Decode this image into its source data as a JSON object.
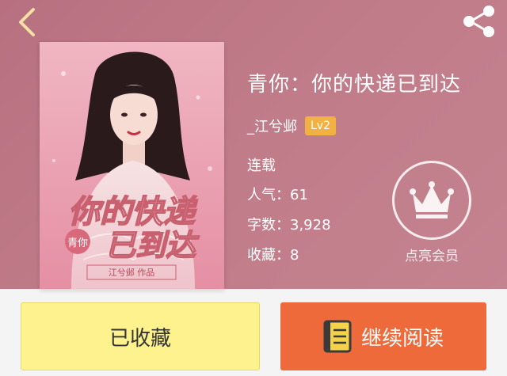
{
  "colors": {
    "header_bg": "#c07b88",
    "level_badge": "#f2b143",
    "favorite_button": "#fdf28e",
    "read_button": "#ef6a3a"
  },
  "nav": {
    "back_icon": "chevron-left-icon",
    "share_icon": "share-icon"
  },
  "book": {
    "title": "青你：你的快递已到达",
    "author": "_江兮邺",
    "level": "Lv2",
    "status": "连载",
    "popularity_label": "人气：61",
    "word_count_label": "字数：3,928",
    "favorites_label": "收藏：8",
    "cover_title_line1": "你的快递",
    "cover_title_line2": "已到达",
    "cover_tag": "青你",
    "cover_author": "江兮邺 作品"
  },
  "vip": {
    "icon": "crown-icon",
    "label": "点亮会员"
  },
  "actions": {
    "favorite_label": "已收藏",
    "read_label": "继续阅读",
    "read_icon": "book-icon"
  }
}
